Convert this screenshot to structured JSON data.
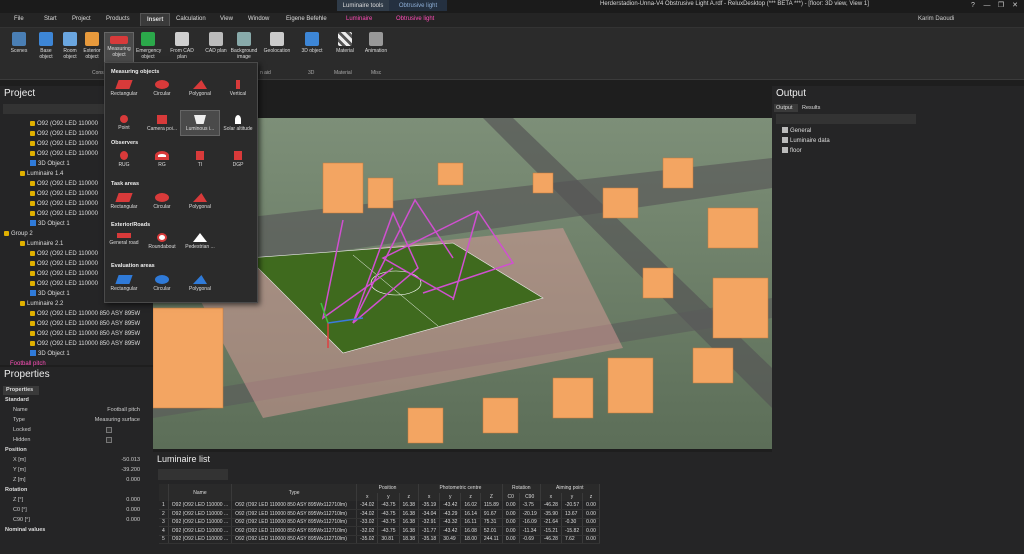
{
  "titlebar": {
    "context_tab_1": "Luminaire tools",
    "context_tab_2": "Obtrusive light",
    "title": "Herderstadion-Unna-V4 Obstrusive Light A.rdf - ReluxDesktop (*** BETA ***) - [floor: 3D view, View 1]",
    "controls": [
      "?",
      "—",
      "❐",
      "✕"
    ]
  },
  "menu": {
    "items": [
      "File",
      "Start",
      "Project",
      "Products",
      "Insert",
      "Calculation",
      "View",
      "Window",
      "Eigene Befehle",
      "Luminaire",
      "Obtrusive light"
    ],
    "active": "Insert",
    "user": "Karim Daoudi"
  },
  "ribbon": {
    "buttons": [
      "Scenes",
      "Base object",
      "Room object",
      "Exterior object",
      "Measuring object",
      "Emergency object",
      "From CAD plan",
      "CAD plan",
      "Background image",
      "Geolocation",
      "3D object",
      "Material",
      "Animation"
    ],
    "groups": [
      "Cons",
      "n aid",
      "3D",
      "Material",
      "Misc"
    ]
  },
  "dropdown": {
    "sections": [
      {
        "title": "Measuring objects",
        "items": [
          "Rectangular",
          "Circular",
          "Polygonal",
          "Vertical",
          "Point",
          "Camera poi...",
          "Luminous i...",
          "Solar altitude"
        ]
      },
      {
        "title": "Observers",
        "items": [
          "RUG",
          "RG",
          "TI",
          "DGP"
        ]
      },
      {
        "title": "Task areas",
        "items": [
          "Rectangular",
          "Circular",
          "Polygonal"
        ]
      },
      {
        "title": "Exterior/Roads",
        "items": [
          "General road",
          "Roundabout",
          "Pedestrian ..."
        ]
      },
      {
        "title": "Evaluation areas",
        "items": [
          "Rectangular",
          "Circular",
          "Polygonal"
        ]
      }
    ]
  },
  "project": {
    "title": "Project",
    "tree": [
      "O92 (O92 LED 110000",
      "O92 (O92 LED 110000",
      "O92 (O92 LED 110000",
      "O92 (O92 LED 110000",
      "3D Object 1",
      "Luminaire 1.4",
      "O92 (O92 LED 110000",
      "O92 (O92 LED 110000",
      "O92 (O92 LED 110000",
      "O92 (O92 LED 110000",
      "3D Object 1",
      "Group 2",
      "Luminaire 2.1",
      "O92 (O92 LED 110000",
      "O92 (O92 LED 110000",
      "O92 (O92 LED 110000",
      "O92 (O92 LED 110000",
      "3D Object 1",
      "Luminaire 2.2",
      "O92 (O92 LED 110000 850 ASY 895W",
      "O92 (O92 LED 110000 850 ASY 895W",
      "O92 (O92 LED 110000 850 ASY 895W",
      "O92 (O92 LED 110000 850 ASY 895W",
      "3D Object 1",
      "Football pitch"
    ]
  },
  "properties": {
    "title": "Properties",
    "tab": "Properties",
    "rows": [
      {
        "k": "Standard",
        "v": "",
        "sec": true
      },
      {
        "k": "Name",
        "v": "Football pitch"
      },
      {
        "k": "Type",
        "v": "Measuring surface"
      },
      {
        "k": "Locked",
        "v": "",
        "cb": true
      },
      {
        "k": "Hidden",
        "v": "",
        "cb": true
      },
      {
        "k": "Position",
        "v": "",
        "sec": true
      },
      {
        "k": "X [m]",
        "v": "-50.013"
      },
      {
        "k": "Y [m]",
        "v": "-39.200"
      },
      {
        "k": "Z [m]",
        "v": "0.000"
      },
      {
        "k": "Rotation",
        "v": "",
        "sec": true
      },
      {
        "k": "Z [°]",
        "v": "0.000"
      },
      {
        "k": "C0 [°]",
        "v": "0.000"
      },
      {
        "k": "C90 [°]",
        "v": "0.000"
      },
      {
        "k": "Nominal values",
        "v": "",
        "sec": true
      }
    ]
  },
  "output": {
    "title": "Output",
    "tabs": [
      "Output",
      "Results"
    ],
    "tree": [
      "General",
      "Luminaire data",
      "floor"
    ]
  },
  "luminaire_list": {
    "title": "Luminaire list",
    "group_headers": [
      "Position",
      "Photometric centre",
      "Rotation",
      "Aiming point"
    ],
    "columns": [
      "Name",
      "Type",
      "x",
      "y",
      "z",
      "x",
      "y",
      "z",
      "Z",
      "C0",
      "C90",
      "x",
      "y",
      "z"
    ],
    "rows": [
      [
        "1",
        "O92 (O92 LED 110000 ...",
        "O92 (O92 LED 110000 850 ASY 895Wx112710lm)",
        "-34.02",
        "-43.75",
        "16.38",
        "-35.19",
        "-43.42",
        "16.02",
        "115.89",
        "0.00",
        "-3.75",
        "-46.28",
        "-20.57",
        "0.00"
      ],
      [
        "2",
        "O92 (O92 LED 110000 ...",
        "O92 (O92 LED 110000 850 ASY 895Wx112710lm)",
        "-34.02",
        "-43.75",
        "16.38",
        "-34.04",
        "-43.29",
        "16.14",
        "91.67",
        "0.00",
        "-20.19",
        "-35.90",
        "13.67",
        "0.00"
      ],
      [
        "3",
        "O92 (O92 LED 110000 ...",
        "O92 (O92 LED 110000 850 ASY 895Wx112710lm)",
        "-33.02",
        "-43.75",
        "16.38",
        "-32.91",
        "-43.32",
        "16.11",
        "75.31",
        "0.00",
        "-16.09",
        "-21.64",
        "-0.30",
        "0.00"
      ],
      [
        "4",
        "O92 (O92 LED 110000 ...",
        "O92 (O92 LED 110000 850 ASY 895Wx112710lm)",
        "-32.02",
        "-43.75",
        "16.38",
        "-31.77",
        "-43.42",
        "16.08",
        "52.01",
        "0.00",
        "-11.34",
        "-15.21",
        "-15.82",
        "0.00"
      ],
      [
        "5",
        "O92 (O92 LED 110000 ...",
        "O92 (O92 LED 110000 850 ASY 895Wx112710lm)",
        "-35.02",
        "30.81",
        "18.38",
        "-35.18",
        "30.49",
        "18.00",
        "244.11",
        "0.00",
        "-0.69",
        "-46.28",
        "7.62",
        "0.00"
      ]
    ]
  }
}
